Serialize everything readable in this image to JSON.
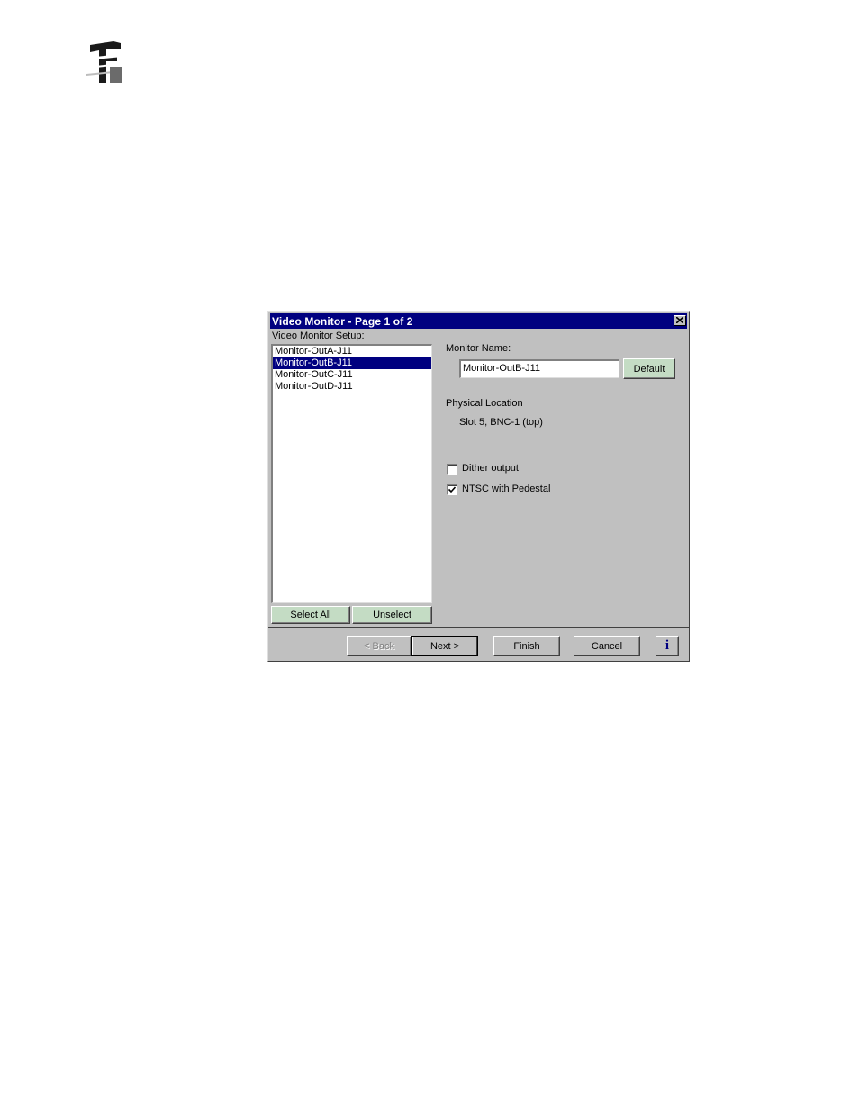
{
  "dialog": {
    "title": "Video Monitor - Page 1 of 2",
    "setup_label": "Video Monitor Setup:",
    "monitors": [
      {
        "label": "Monitor-OutA-J11",
        "selected": false
      },
      {
        "label": "Monitor-OutB-J11",
        "selected": true
      },
      {
        "label": "Monitor-OutC-J11",
        "selected": false
      },
      {
        "label": "Monitor-OutD-J11",
        "selected": false
      }
    ],
    "select_all_label": "Select All",
    "unselect_label": "Unselect",
    "monitor_name_label": "Monitor Name:",
    "monitor_name_value": "Monitor-OutB-J11",
    "default_label": "Default",
    "physical_location_label": "Physical Location",
    "physical_location_value": "Slot 5, BNC-1 (top)",
    "dither_label": "Dither output",
    "dither_checked": false,
    "ntsc_label": "NTSC with Pedestal",
    "ntsc_checked": true,
    "buttons": {
      "back": "< Back",
      "next": "Next >",
      "finish": "Finish",
      "cancel": "Cancel",
      "info": "i"
    }
  },
  "colors": {
    "titlebar": "#000080",
    "dialog_bg": "#c0c0c0",
    "selection": "#000080",
    "green_button": "#c4dcc4"
  }
}
